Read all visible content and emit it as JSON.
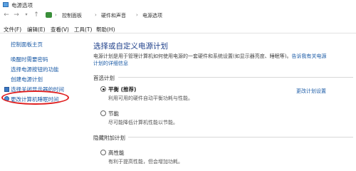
{
  "window": {
    "title": "电源选项"
  },
  "address": {
    "crumbs": [
      "控制面板",
      "硬件和声音",
      "电源选项"
    ]
  },
  "menu": [
    "文件(F)",
    "编辑(E)",
    "查看(V)",
    "工具(T)",
    "帮助(H)"
  ],
  "sidebar": {
    "items": [
      {
        "label": "控制面板主页"
      },
      {
        "label": "唤醒时需要密码"
      },
      {
        "label": "选择电源按钮的功能"
      },
      {
        "label": "创建电源计划"
      },
      {
        "label": "选择关闭显示器的时间"
      },
      {
        "label": "更改计算机睡眠时间"
      }
    ]
  },
  "main": {
    "heading": "选择或自定义电源计划",
    "desc_line1": "电源计划是用于管理计算机如何使用电源的一套硬件和系统设置(如显示器亮度、睡眠等)。",
    "desc_link1": "告诉我有关电源",
    "desc_link2": "计划的详细信息",
    "preferred_title": "首选计划",
    "extra_title": "隐藏附加计划",
    "change_link": "更改计划设置",
    "plans": [
      {
        "name": "平衡 (推荐)",
        "desc": "利用可用的硬件自动平衡功耗与性能。",
        "checked": true
      },
      {
        "name": "节能",
        "desc": "尽可能降低计算机性能以节能。",
        "checked": false
      },
      {
        "name": "高性能",
        "desc": "有利于提高性能，但会增加功耗。",
        "checked": false
      }
    ]
  },
  "colors": {
    "link": "#1a5aa6",
    "heading": "#1e3f8a",
    "annotation": "#e02020"
  }
}
